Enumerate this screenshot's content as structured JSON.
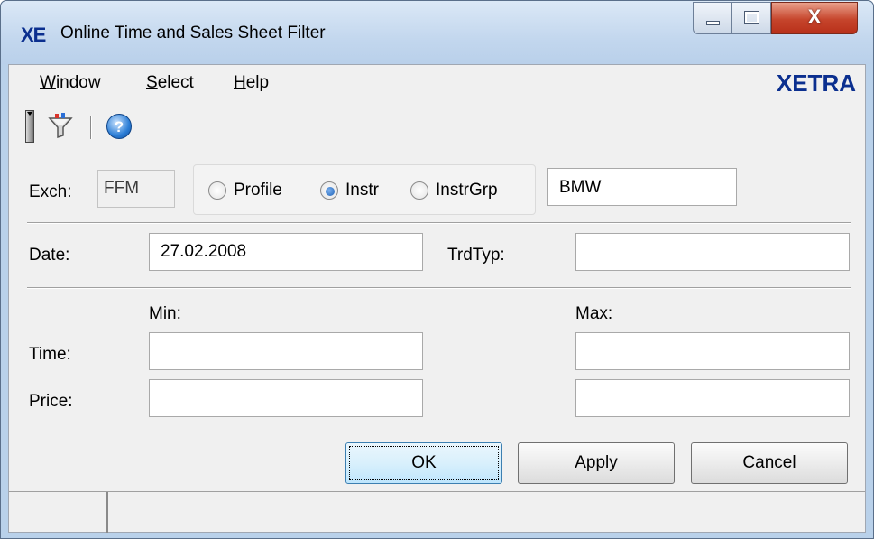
{
  "window": {
    "logo": "XE",
    "title": "Online Time and Sales Sheet Filter",
    "close_glyph": "X"
  },
  "menu": {
    "items": [
      {
        "label": "Window",
        "mnemonic": "W",
        "rest": "indow"
      },
      {
        "label": "Select",
        "mnemonic": "S",
        "rest": "elect"
      },
      {
        "label": "Help",
        "mnemonic": "H",
        "rest": "elp"
      }
    ],
    "brand": "XETRA"
  },
  "toolbar": {
    "icons": [
      "toolbar-grip",
      "filter-icon",
      "help-icon"
    ],
    "help_glyph": "?"
  },
  "filter": {
    "exch_label": "Exch:",
    "exch_value": "FFM",
    "radio_options": [
      {
        "label": "Profile",
        "selected": false
      },
      {
        "label": "Instr",
        "selected": true
      },
      {
        "label": "InstrGrp",
        "selected": false
      }
    ],
    "instrument_value": "BMW",
    "date_label": "Date:",
    "date_value": "27.02.2008",
    "trdtyp_label": "TrdTyp:",
    "trdtyp_value": "",
    "min_label": "Min:",
    "max_label": "Max:",
    "time_label": "Time:",
    "price_label": "Price:",
    "time_min": "",
    "time_max": "",
    "price_min": "",
    "price_max": ""
  },
  "buttons": {
    "ok": {
      "label": "OK",
      "before": "",
      "mnemonic": "O",
      "after": "K"
    },
    "apply": {
      "label": "Apply",
      "before": "Appl",
      "mnemonic": "y",
      "after": ""
    },
    "cancel": {
      "label": "Cancel",
      "before": "",
      "mnemonic": "C",
      "after": "ancel"
    }
  },
  "colors": {
    "brand": "#0b2f8f",
    "title_bar": "#c3d7ee",
    "close_button": "#c6452c",
    "radio_selected": "#1b5fb4"
  }
}
